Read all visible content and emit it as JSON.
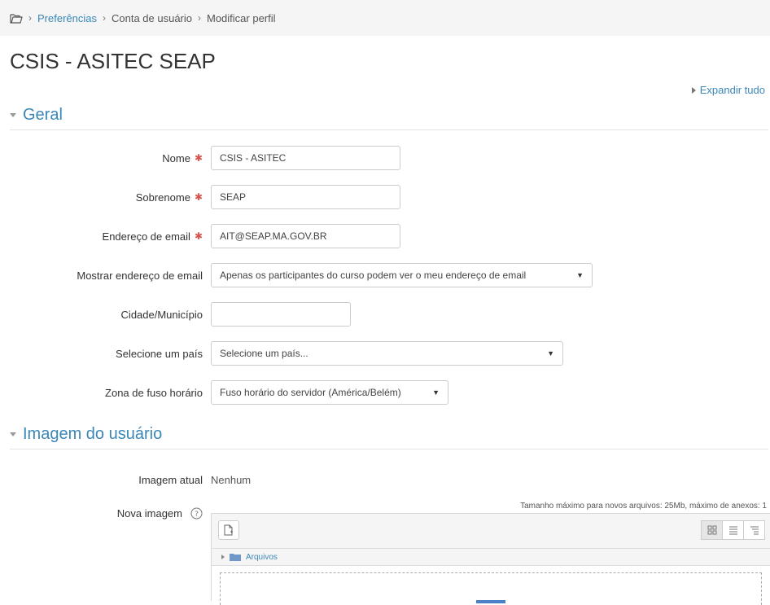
{
  "breadcrumb": {
    "items": [
      "Preferências",
      "Conta de usuário",
      "Modificar perfil"
    ]
  },
  "page_title": "CSIS - ASITEC SEAP",
  "expand_all": "Expandir tudo",
  "sections": {
    "general": "Geral",
    "user_image": "Imagem do usuário"
  },
  "form": {
    "first_name": {
      "label": "Nome",
      "value": "CSIS - ASITEC"
    },
    "last_name": {
      "label": "Sobrenome",
      "value": "SEAP"
    },
    "email": {
      "label": "Endereço de email",
      "value": "AIT@SEAP.MA.GOV.BR"
    },
    "email_display": {
      "label": "Mostrar endereço de email",
      "value": "Apenas os participantes do curso podem ver o meu endereço de email"
    },
    "city": {
      "label": "Cidade/Município",
      "value": ""
    },
    "country": {
      "label": "Selecione um país",
      "value": "Selecione um país..."
    },
    "timezone": {
      "label": "Zona de fuso horário",
      "value": "Fuso horário do servidor (América/Belém)"
    }
  },
  "image": {
    "current_label": "Imagem atual",
    "current_value": "Nenhum",
    "new_label": "Nova imagem",
    "limits": "Tamanho máximo para novos arquivos: 25Mb, máximo de anexos: 1",
    "path_folder": "Arquivos"
  },
  "colors": {
    "accent": "#3a87b8",
    "required": "#d9534f"
  },
  "icons": [
    "folder-icon",
    "help-icon",
    "add-file-icon",
    "grid-view-icon",
    "list-view-icon",
    "tree-view-icon"
  ]
}
